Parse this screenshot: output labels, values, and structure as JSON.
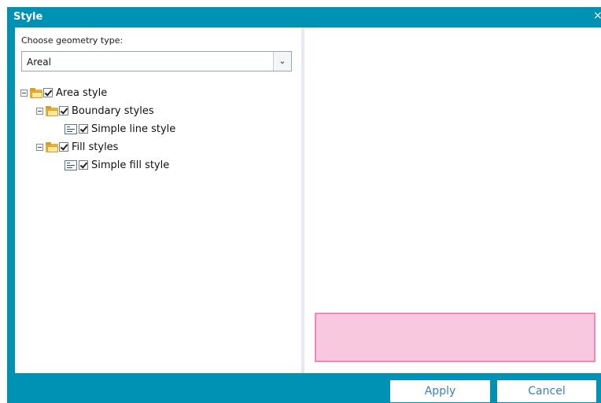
{
  "dialog": {
    "title": "Style",
    "close_label": "×"
  },
  "geometry": {
    "label": "Choose geometry type:",
    "selected": "Areal"
  },
  "tree": {
    "area_style": "Area style",
    "boundary_styles": "Boundary styles",
    "simple_line_style": "Simple line style",
    "fill_styles": "Fill styles",
    "simple_fill_style": "Simple fill style"
  },
  "preview": {
    "fill_color": "#f7c8de",
    "stroke_color": "#ee8ab5"
  },
  "footer": {
    "apply_label": "Apply",
    "cancel_label": "Cancel"
  },
  "colors": {
    "accent": "#0092b5"
  }
}
